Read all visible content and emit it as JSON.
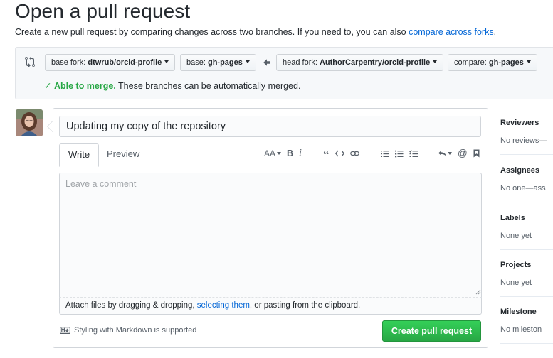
{
  "page": {
    "title": "Open a pull request",
    "subtitle_prefix": "Create a new pull request by comparing changes across two branches. If you need to, you can also ",
    "subtitle_link": "compare across forks",
    "subtitle_suffix": "."
  },
  "range": {
    "base_fork_label": "base fork: ",
    "base_fork_value": "dtwrub/orcid-profile",
    "base_label": "base: ",
    "base_value": "gh-pages",
    "head_fork_label": "head fork: ",
    "head_fork_value": "AuthorCarpentry/orcid-profile",
    "compare_label": "compare: ",
    "compare_value": "gh-pages",
    "merge_status_check": "✓",
    "merge_status_strong": "Able to merge.",
    "merge_status_text": " These branches can be automatically merged."
  },
  "form": {
    "title_value": "Updating my copy of the repository",
    "tabs": [
      {
        "label": "Write",
        "active": true
      },
      {
        "label": "Preview",
        "active": false
      }
    ],
    "comment_placeholder": "Leave a comment",
    "attach_prefix": "Attach files by dragging & dropping, ",
    "attach_link": "selecting them",
    "attach_suffix": ", or pasting from the clipboard.",
    "markdown_note": "Styling with Markdown is supported",
    "submit_label": "Create pull request",
    "toolbar_icons": [
      "header-icon",
      "bold-icon",
      "italic-icon",
      "quote-icon",
      "code-icon",
      "link-icon",
      "unordered-list-icon",
      "ordered-list-icon",
      "task-list-icon",
      "reply-icon",
      "mention-icon",
      "bookmark-icon"
    ],
    "toolbar_text": {
      "header": "AA",
      "bold": "B",
      "italic": "i",
      "quote": "“",
      "mention": "@"
    }
  },
  "sidebar": {
    "sections": [
      {
        "heading": "Reviewers",
        "value": "No reviews—"
      },
      {
        "heading": "Assignees",
        "value": "No one—ass"
      },
      {
        "heading": "Labels",
        "value": "None yet"
      },
      {
        "heading": "Projects",
        "value": "None yet"
      },
      {
        "heading": "Milestone",
        "value": "No mileston"
      }
    ]
  },
  "colors": {
    "link": "#0366d6",
    "success": "#28a745",
    "button_green": "#2cbe4e"
  }
}
